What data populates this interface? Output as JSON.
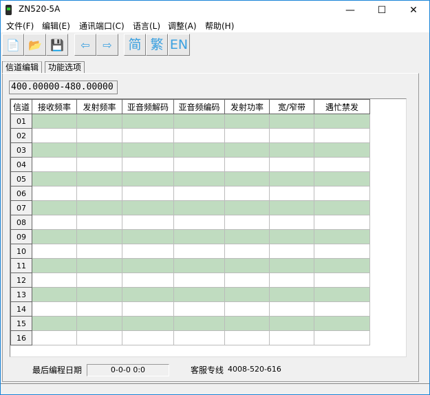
{
  "window": {
    "title": "ZN520-5A",
    "minimize": "—",
    "maximize": "☐",
    "close": "✕"
  },
  "menu": [
    "文件(F)",
    "编辑(E)",
    "通讯端口(C)",
    "语言(L)",
    "调整(A)",
    "帮助(H)"
  ],
  "toolbar": [
    {
      "name": "new-file",
      "glyph": "📄"
    },
    {
      "name": "open-folder",
      "glyph": "📂"
    },
    {
      "name": "save",
      "glyph": "💾"
    },
    {
      "name": "read-from-radio",
      "glyph": "⇦"
    },
    {
      "name": "write-to-radio",
      "glyph": "⇨"
    },
    {
      "name": "simplified-chinese",
      "glyph": "简"
    },
    {
      "name": "traditional-chinese",
      "glyph": "繁"
    },
    {
      "name": "english",
      "glyph": "EN"
    }
  ],
  "tabs": [
    "信道编辑",
    "功能选项"
  ],
  "frequency_range": "400.00000-480.00000",
  "table": {
    "headers": [
      "信道",
      "接收频率",
      "发射频率",
      "亚音频解码",
      "亚音频编码",
      "发射功率",
      "宽/窄带",
      "遇忙禁发"
    ],
    "rows": [
      "01",
      "02",
      "03",
      "04",
      "05",
      "06",
      "07",
      "08",
      "09",
      "10",
      "11",
      "12",
      "13",
      "14",
      "15",
      "16"
    ]
  },
  "status": {
    "last_program_label": "最后编程日期",
    "last_program_value": "0-0-0   0:0",
    "service_label": "客服专线",
    "service_phone": "4008-520-616"
  },
  "colors": {
    "row_highlight": "#c0dcc0",
    "accent": "#1883d7"
  }
}
